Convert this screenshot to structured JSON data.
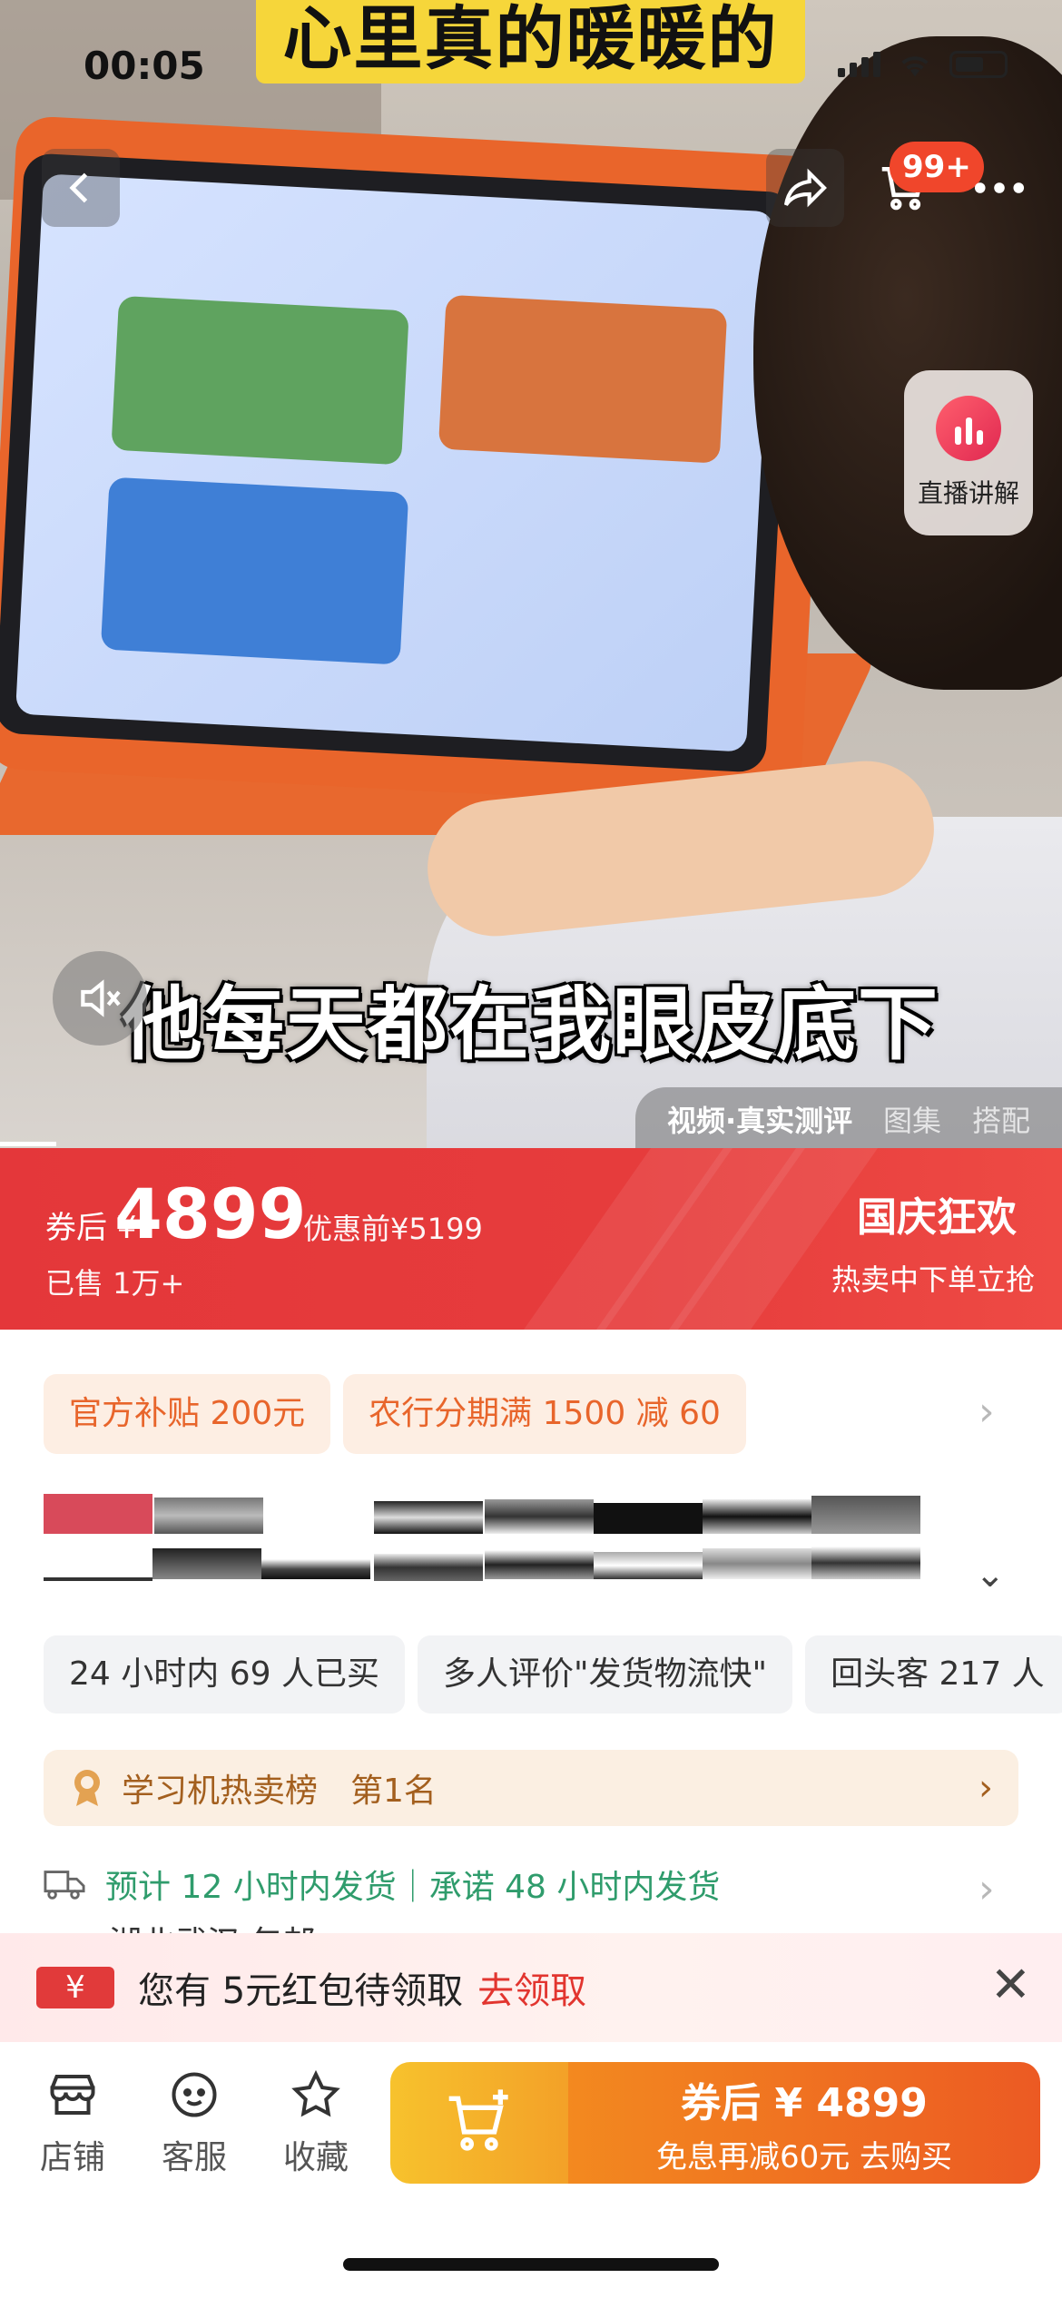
{
  "status_bar": {
    "time": "00:05"
  },
  "header": {
    "cart_badge": "99+"
  },
  "video": {
    "caption_top": "心里真的暖暖的",
    "caption_bottom": "他每天都在我眼皮底下",
    "live_label": "直播讲解",
    "tabs": [
      {
        "label": "视频·真实测评",
        "active": true
      },
      {
        "label": "图集",
        "active": false
      },
      {
        "label": "搭配",
        "active": false
      }
    ]
  },
  "price": {
    "after_label": "券后 ¥",
    "value": "4899",
    "before": "优惠前¥5199",
    "sold": "已售 1万+",
    "promo_title": "国庆狂欢",
    "promo_sub": "热卖中下单立抢"
  },
  "coupons": [
    "官方补贴 200元",
    "农行分期满 1500 减 60"
  ],
  "tags": [
    "24 小时内 69 人已买",
    "多人评价\"发货物流快\"",
    "回头客 217 人"
  ],
  "rank": {
    "label": "学习机热卖榜",
    "position": "第1名"
  },
  "shipping": {
    "text": "预计 12 小时内发货｜承诺 48 小时内发货",
    "address": "湖北武汉 包邮"
  },
  "red_packet": {
    "yen": "¥",
    "text": "您有 5元红包待领取",
    "link": "去领取"
  },
  "bottom_nav": [
    {
      "label": "店铺",
      "icon": "store-icon"
    },
    {
      "label": "客服",
      "icon": "service-icon"
    },
    {
      "label": "收藏",
      "icon": "star-icon"
    }
  ],
  "buy": {
    "main": "券后 ¥ 4899",
    "sub": "免息再减60元  去购买"
  },
  "colors": {
    "accent_red": "#e4373a",
    "orange": "#ec5a23",
    "green": "#2f9c6c"
  }
}
